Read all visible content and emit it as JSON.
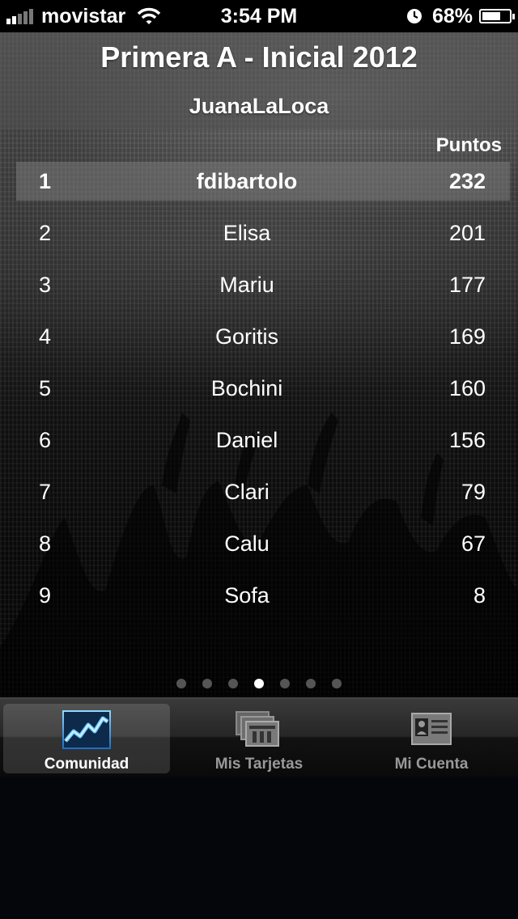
{
  "status_bar": {
    "carrier": "movistar",
    "time": "3:54 PM",
    "battery_percent": "68%",
    "battery_level": 0.68,
    "signal_bars": 2
  },
  "header": {
    "title": "Primera A - Inicial 2012",
    "community": "JuanaLaLoca"
  },
  "ranking": {
    "points_header": "Puntos",
    "rows": [
      {
        "position": "1",
        "name": "fdibartolo",
        "points": "232",
        "highlight": true
      },
      {
        "position": "2",
        "name": "Elisa",
        "points": "201"
      },
      {
        "position": "3",
        "name": "Mariu",
        "points": "177"
      },
      {
        "position": "4",
        "name": "Goritis",
        "points": "169"
      },
      {
        "position": "5",
        "name": "Bochini",
        "points": "160"
      },
      {
        "position": "6",
        "name": "Daniel",
        "points": "156"
      },
      {
        "position": "7",
        "name": "Clari",
        "points": "79"
      },
      {
        "position": "8",
        "name": "Calu",
        "points": "67"
      },
      {
        "position": "9",
        "name": "Sofa",
        "points": "8"
      }
    ]
  },
  "pagination": {
    "pages": 7,
    "current": 4
  },
  "tabs": [
    {
      "label": "Comunidad",
      "icon": "chart-icon",
      "selected": true
    },
    {
      "label": "Mis Tarjetas",
      "icon": "cards-icon",
      "selected": false
    },
    {
      "label": "Mi Cuenta",
      "icon": "id-card-icon",
      "selected": false
    }
  ],
  "colors": {
    "highlight_row": "#7a7a7a",
    "active_dot": "#ffffff",
    "inactive_dot": "#555555",
    "tab_label_inactive": "#999999"
  }
}
